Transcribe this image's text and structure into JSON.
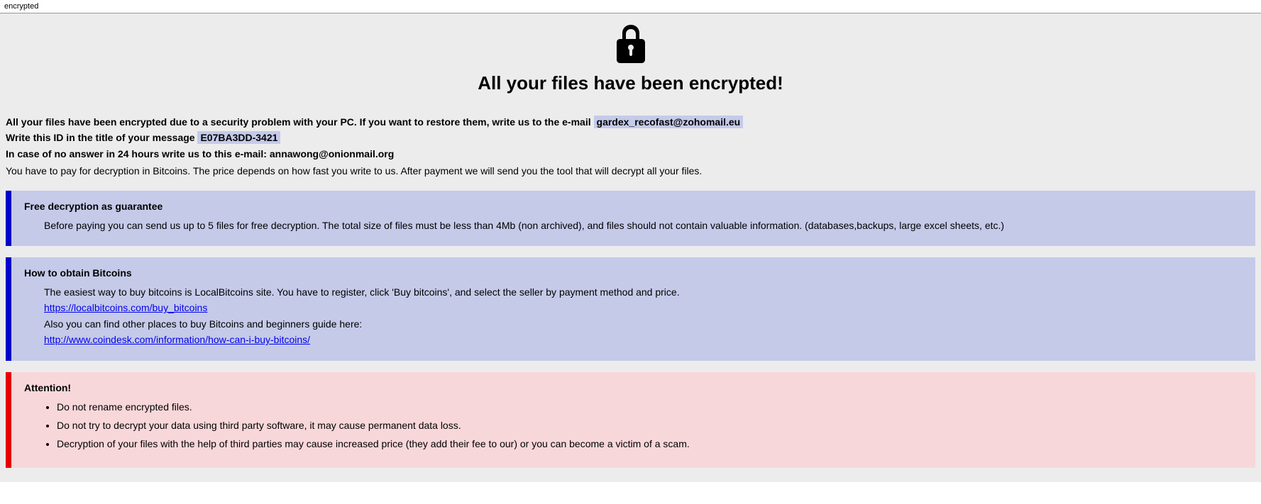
{
  "window": {
    "title": "encrypted"
  },
  "header": {
    "title": "All your files have been encrypted!"
  },
  "intro": {
    "line1_prefix": "All your files have been encrypted due to a security problem with your PC. If you want to restore them, write us to the e-mail ",
    "email1": "gardex_recofast@zohomail.eu",
    "line2_prefix": "Write this ID in the title of your message ",
    "id": "E07BA3DD-3421",
    "line3_prefix": "In case of no answer in 24 hours write us to this e-mail: ",
    "email2": "annawong@onionmail.org",
    "line4": "You have to pay for decryption in Bitcoins. The price depends on how fast you write to us. After payment we will send you the tool that will decrypt all your files."
  },
  "panel_free": {
    "heading": "Free decryption as guarantee",
    "body": "Before paying you can send us up to 5 files for free decryption. The total size of files must be less than 4Mb (non archived), and files should not contain valuable information. (databases,backups, large excel sheets, etc.)"
  },
  "panel_bitcoin": {
    "heading": "How to obtain Bitcoins",
    "line1": "The easiest way to buy bitcoins is LocalBitcoins site. You have to register, click 'Buy bitcoins', and select the seller by payment method and price.",
    "link1": "https://localbitcoins.com/buy_bitcoins",
    "line2": "Also you can find other places to buy Bitcoins and beginners guide here:",
    "link2": "http://www.coindesk.com/information/how-can-i-buy-bitcoins/"
  },
  "panel_attention": {
    "heading": "Attention!",
    "items": [
      "Do not rename encrypted files.",
      "Do not try to decrypt your data using third party software, it may cause permanent data loss.",
      "Decryption of your files with the help of third parties may cause increased price (they add their fee to our) or you can become a victim of a scam."
    ]
  }
}
